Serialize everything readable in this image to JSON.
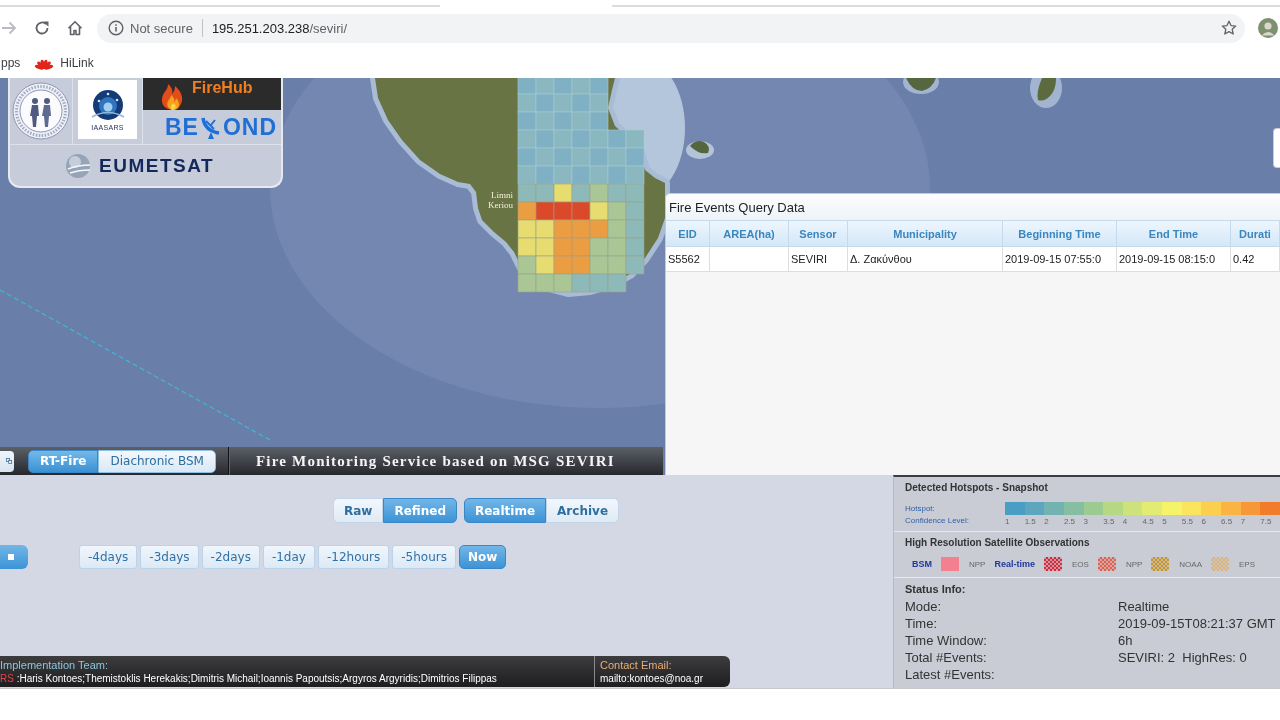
{
  "browser": {
    "nav_buttons": [
      {
        "kind": "forward",
        "disabled": true
      },
      {
        "kind": "reload",
        "disabled": false
      },
      {
        "kind": "home",
        "disabled": false
      }
    ],
    "security": "Not secure",
    "url": {
      "host": "195.251.203.238",
      "path": "/seviri/"
    },
    "bookmarks": [
      {
        "kind": "apps",
        "label": "pps"
      },
      {
        "kind": "site",
        "label": "HiLink"
      }
    ]
  },
  "logos": {
    "institute": "IAASARS",
    "firehub": "FireHub",
    "beyond": {
      "start": "BE",
      "end": "OND"
    },
    "eumetsat": "EUMETSAT"
  },
  "map": {
    "labels": [
      "Limni",
      "Keriou"
    ]
  },
  "events_panel": {
    "title": "Fire Events Query Data",
    "columns": [
      "EID",
      "AREA(ha)",
      "Sensor",
      "Municipality",
      "Beginning Time",
      "End Time",
      "Durati"
    ],
    "rows": [
      [
        "S5562",
        null,
        "SEVIRI",
        "Δ. Ζακύνθου",
        "2019-09-15 07:55:0",
        "2019-09-15 08:15:0",
        "0.42"
      ]
    ]
  },
  "toolbar": {
    "tabs": [
      {
        "label": "RT-Fire",
        "selected": true
      },
      {
        "label": "Diachronic BSM",
        "selected": false
      }
    ],
    "title": "Fire Monitoring Service based on MSG SEVIRI"
  },
  "controls": {
    "product_toggle": [
      {
        "label": "Raw",
        "selected": false
      },
      {
        "label": "Refined",
        "selected": true
      }
    ],
    "mode_toggle": [
      {
        "label": "Realtime",
        "selected": true
      },
      {
        "label": "Archive",
        "selected": false
      }
    ],
    "time_buttons": [
      {
        "label": "-4days",
        "selected": false
      },
      {
        "label": "-3days",
        "selected": false
      },
      {
        "label": "-2days",
        "selected": false
      },
      {
        "label": "-1day",
        "selected": false
      },
      {
        "label": "-12hours",
        "selected": false
      },
      {
        "label": "-5hours",
        "selected": false
      },
      {
        "label": "Now",
        "selected": true
      }
    ]
  },
  "footer": {
    "team_heading": "Implementation Team:",
    "team_prefix": "RS",
    "team_members": ":Haris Kontoes;Themistoklis Herekakis;Dimitris Michail;Ioannis Papoutsis;Argyros Argyridis;Dimitrios Filippas",
    "contact_heading": "Contact Email:",
    "contact_email": "mailto:kontoes@noa.gr"
  },
  "legend": {
    "hotspots_title": "Detected Hotspots - Snapshot",
    "hotspot_label": "Hotspot:",
    "confidence_label": "Confidence Level:",
    "scale": [
      {
        "label": "1",
        "color": "#4a9ec4"
      },
      {
        "label": "1.5",
        "color": "#5ea6bd"
      },
      {
        "label": "2",
        "color": "#72b2b0"
      },
      {
        "label": "2.5",
        "color": "#86bea3"
      },
      {
        "label": "3",
        "color": "#9ccb92"
      },
      {
        "label": "3.5",
        "color": "#b6d783"
      },
      {
        "label": "4",
        "color": "#cde27a"
      },
      {
        "label": "4.5",
        "color": "#e2ec72"
      },
      {
        "label": "5",
        "color": "#f5f36a"
      },
      {
        "label": "5.5",
        "color": "#fbe55e"
      },
      {
        "label": "6",
        "color": "#fccf4f"
      },
      {
        "label": "6.5",
        "color": "#fab444"
      },
      {
        "label": "7",
        "color": "#f69838"
      },
      {
        "label": "7.5",
        "color": "#f07c2c"
      }
    ],
    "observations_title": "High Resolution Satellite Observations",
    "groups": [
      {
        "title": "BSM",
        "items": [
          {
            "kind": "solid",
            "color": "#f4808f",
            "label": "NPP"
          }
        ]
      },
      {
        "title": "Real-time",
        "items": [
          {
            "kind": "hatch",
            "color": "#d42a3a",
            "label": "EOS"
          },
          {
            "kind": "hatch",
            "color": "#e0604c",
            "label": "NPP"
          },
          {
            "kind": "hatch",
            "color": "#c8952a",
            "label": "NOAA"
          },
          {
            "kind": "hatch",
            "color": "#dcb47c",
            "label": "EPS"
          }
        ]
      }
    ]
  },
  "status": {
    "title": "Status Info:",
    "rows": [
      {
        "label": "Mode:",
        "value": "Realtime"
      },
      {
        "label": "Time:",
        "value": "2019-09-15T08:21:37 GMT"
      },
      {
        "label": "Time Window:",
        "value": "6h"
      },
      {
        "label": "Total #Events:",
        "value": "SEVIRI: 2  HighRes: 0"
      },
      {
        "label": "Latest #Events:"
      }
    ]
  }
}
